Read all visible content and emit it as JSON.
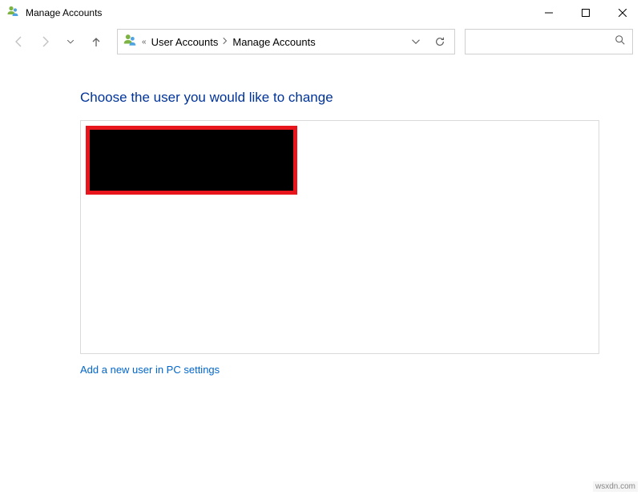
{
  "window": {
    "title": "Manage Accounts"
  },
  "breadcrumb": {
    "segments": [
      "User Accounts",
      "Manage Accounts"
    ]
  },
  "page": {
    "heading": "Choose the user you would like to change",
    "add_user_link": "Add a new user in PC settings"
  },
  "watermark": "wsxdn.com"
}
